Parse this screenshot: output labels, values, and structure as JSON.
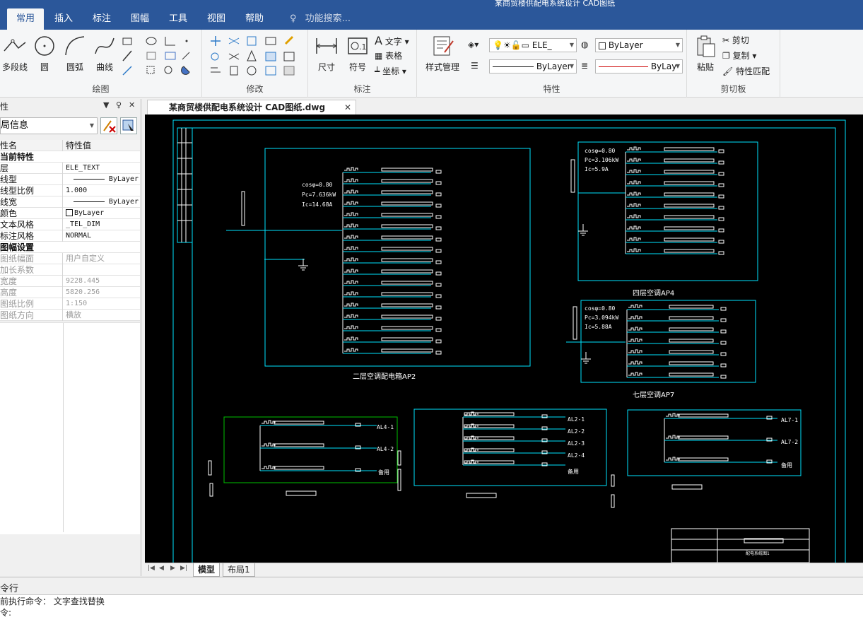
{
  "window": {
    "title_fragment": "某商贸楼供配电系统设计 CAD图纸"
  },
  "ribbon_tabs": [
    {
      "label": "常用",
      "active": true
    },
    {
      "label": "插入",
      "active": false
    },
    {
      "label": "标注",
      "active": false
    },
    {
      "label": "图幅",
      "active": false
    },
    {
      "label": "工具",
      "active": false
    },
    {
      "label": "视图",
      "active": false
    },
    {
      "label": "帮助",
      "active": false
    }
  ],
  "search": {
    "placeholder": "功能搜索..."
  },
  "ribbon": {
    "draw": {
      "label": "绘图",
      "polyline": "多段线",
      "circle": "圆",
      "arc": "圆弧",
      "curve": "曲线"
    },
    "modify": {
      "label": "修改"
    },
    "annotate": {
      "label": "标注",
      "dimension": "尺寸",
      "symbol": "符号",
      "text": "文字",
      "table": "表格",
      "coordinate": "坐标"
    },
    "properties": {
      "label": "特性",
      "style_manager": "样式管理",
      "layer_value": "ELE_",
      "color_value": "ByLayer",
      "linetype_value": "ByLayer",
      "lineweight_value": "ByLay"
    },
    "clipboard": {
      "label": "剪切板",
      "paste": "粘贴",
      "cut": "剪切",
      "copy": "复制",
      "match": "特性匹配"
    }
  },
  "panel": {
    "title": "性",
    "selector": "局信息",
    "col_name": "性名",
    "col_value": "特性值",
    "rows": [
      {
        "type": "section",
        "name": "当前特性",
        "value": ""
      },
      {
        "type": "row",
        "name": "层",
        "value": "ELE_TEXT"
      },
      {
        "type": "row",
        "name": "线型",
        "value": "ByLayer"
      },
      {
        "type": "row",
        "name": "线型比例",
        "value": "1.000"
      },
      {
        "type": "row",
        "name": "线宽",
        "value": "ByLayer"
      },
      {
        "type": "row",
        "name": "颜色",
        "value": "ByLayer"
      },
      {
        "type": "row",
        "name": "文本风格",
        "value": "_TEL_DIM"
      },
      {
        "type": "row",
        "name": "标注风格",
        "value": "NORMAL"
      },
      {
        "type": "section",
        "name": "图幅设置",
        "value": ""
      },
      {
        "type": "grey",
        "name": "图纸幅面",
        "value": "用户自定义"
      },
      {
        "type": "grey",
        "name": "加长系数",
        "value": ""
      },
      {
        "type": "grey",
        "name": "宽度",
        "value": "9228.445"
      },
      {
        "type": "grey",
        "name": "高度",
        "value": "5820.256"
      },
      {
        "type": "grey",
        "name": "图纸比例",
        "value": "1:150"
      },
      {
        "type": "grey",
        "name": "图纸方向",
        "value": "横放"
      }
    ]
  },
  "document_tab": {
    "label": "某商贸楼供配电系统设计 CAD图纸.dwg"
  },
  "drawing": {
    "ap2": {
      "p1": "cosφ=0.80",
      "p2": "Pc=7.636kW",
      "p3": "Ic=14.68A",
      "caption": "二层空调配电箱AP2"
    },
    "ap4": {
      "p1": "cosφ=0.80",
      "p2": "Pc=3.106kW",
      "p3": "Ic=5.9A",
      "caption": "四层空调AP4"
    },
    "ap7": {
      "p1": "cosφ=0.80",
      "p2": "Pc=3.094kW",
      "p3": "Ic=5.88A",
      "caption": "七层空调AP7"
    },
    "al4": {
      "o1": "AL4-1",
      "o2": "AL4-2",
      "o3": "备用"
    },
    "al2": {
      "o1": "AL2-1",
      "o2": "AL2-2",
      "o3": "AL2-3",
      "o4": "AL2-4",
      "o5": "备用"
    },
    "al7": {
      "o1": "AL7-1",
      "o2": "AL7-2",
      "o3": "备用"
    },
    "title_block": "配电系统图1"
  },
  "layout_tabs": [
    {
      "label": "模型",
      "active": true
    },
    {
      "label": "布局1",
      "active": false
    }
  ],
  "command": {
    "title": "令行",
    "line1": "前执行命令：  文字查找替换",
    "line2": "令:"
  },
  "colors": {
    "accent": "#2b579a",
    "cad_bg": "#000000",
    "cad_cyan": "#00e5ff",
    "cad_white": "#ffffff",
    "cad_green": "#00c000"
  }
}
